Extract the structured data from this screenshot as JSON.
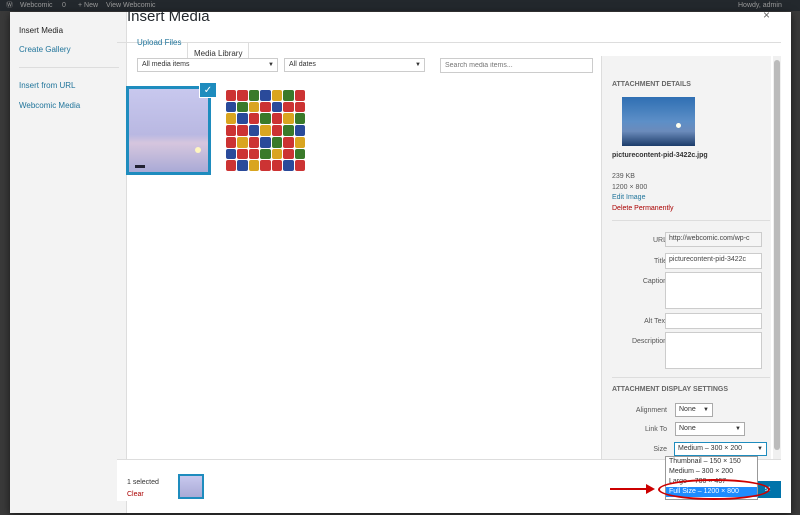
{
  "adminbar": {
    "site": "Webcomic",
    "comments": "0",
    "new": "+ New",
    "view": "View Webcomic",
    "howdy": "Howdy, admin"
  },
  "menu": {
    "items": [
      {
        "label": "Insert Media"
      },
      {
        "label": "Create Gallery"
      },
      {
        "label": "Insert from URL"
      },
      {
        "label": "Webcomic Media"
      }
    ]
  },
  "header": {
    "title": "Insert Media",
    "close": "×"
  },
  "tabs": [
    {
      "label": "Upload Files"
    },
    {
      "label": "Media Library"
    }
  ],
  "filters": {
    "type": "All media items",
    "date": "All dates",
    "search_placeholder": "Search media items..."
  },
  "details": {
    "heading": "Attachment Details",
    "filename": "picturecontent-pid-3422c.jpg",
    "size": "239 KB",
    "dimensions": "1200 × 800",
    "edit": "Edit Image",
    "delete": "Delete Permanently",
    "url_label": "URL",
    "url_value": "http://webcomic.com/wp-c",
    "title_label": "Title",
    "title_value": "picturecontent-pid-3422c",
    "caption_label": "Caption",
    "alt_label": "Alt Text",
    "description_label": "Description"
  },
  "display": {
    "heading": "Attachment Display Settings",
    "alignment_label": "Alignment",
    "alignment_value": "None",
    "link_label": "Link To",
    "link_value": "None",
    "size_label": "Size",
    "size_value": "Medium – 300 × 200",
    "size_options": [
      "Thumbnail – 150 × 150",
      "Medium – 300 × 200",
      "Large – 700 × 467",
      "Full Size – 1200 × 800"
    ]
  },
  "footer": {
    "selected": "1 selected",
    "clear": "Clear",
    "insert": "st"
  },
  "colors": {
    "accent": "#1e8cbe",
    "link": "#21759b",
    "danger": "#aa0000",
    "annotation": "#cc0000"
  }
}
